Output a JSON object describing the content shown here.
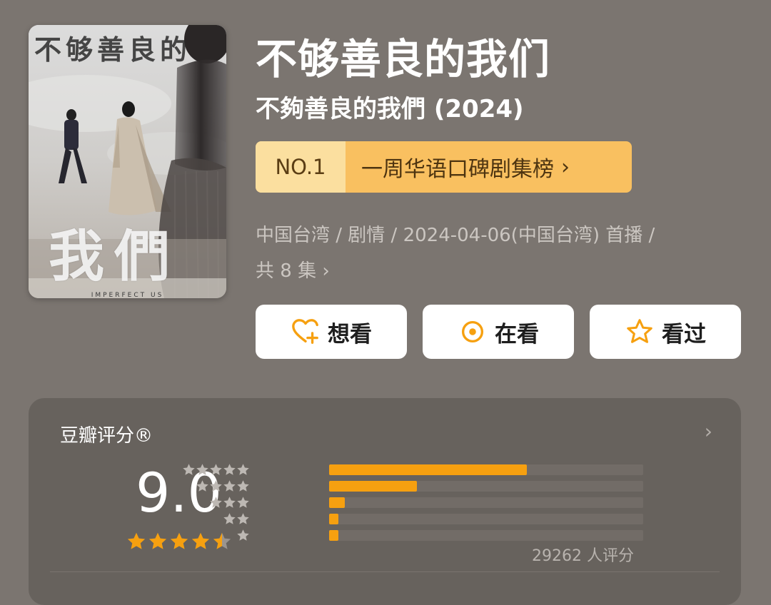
{
  "poster": {
    "title_art": "不够善良的",
    "big_art": "我們",
    "english": "IMPERFECT US"
  },
  "header": {
    "title": "不够善良的我们",
    "subtitle": "不夠善良的我們 (2024)"
  },
  "ranking": {
    "number": "NO.1",
    "label": "一周华语口碑剧集榜",
    "chevron": "›"
  },
  "meta": {
    "line": "中国台湾 / 剧情 / 2024-04-06(中国台湾) 首播 /",
    "episodes": "共 8 集",
    "chevron": "›"
  },
  "actions": [
    {
      "label": "想看",
      "icon": "heart-plus-icon"
    },
    {
      "label": "在看",
      "icon": "target-icon"
    },
    {
      "label": "看过",
      "icon": "star-outline-icon"
    }
  ],
  "rating": {
    "label": "豆瓣评分®",
    "chevron": "›",
    "score": "9.0",
    "stars_filled": 4.5,
    "distribution": [
      {
        "stars": 5,
        "percent": 63
      },
      {
        "stars": 4,
        "percent": 28
      },
      {
        "stars": 3,
        "percent": 5
      },
      {
        "stars": 2,
        "percent": 3
      },
      {
        "stars": 1,
        "percent": 3
      }
    ],
    "count_text": "29262 人评分"
  },
  "colors": {
    "background": "#7b7570",
    "accent": "#f6a010",
    "rank_bg": "#f9c060",
    "rank_no_bg": "#fbdf9f"
  }
}
